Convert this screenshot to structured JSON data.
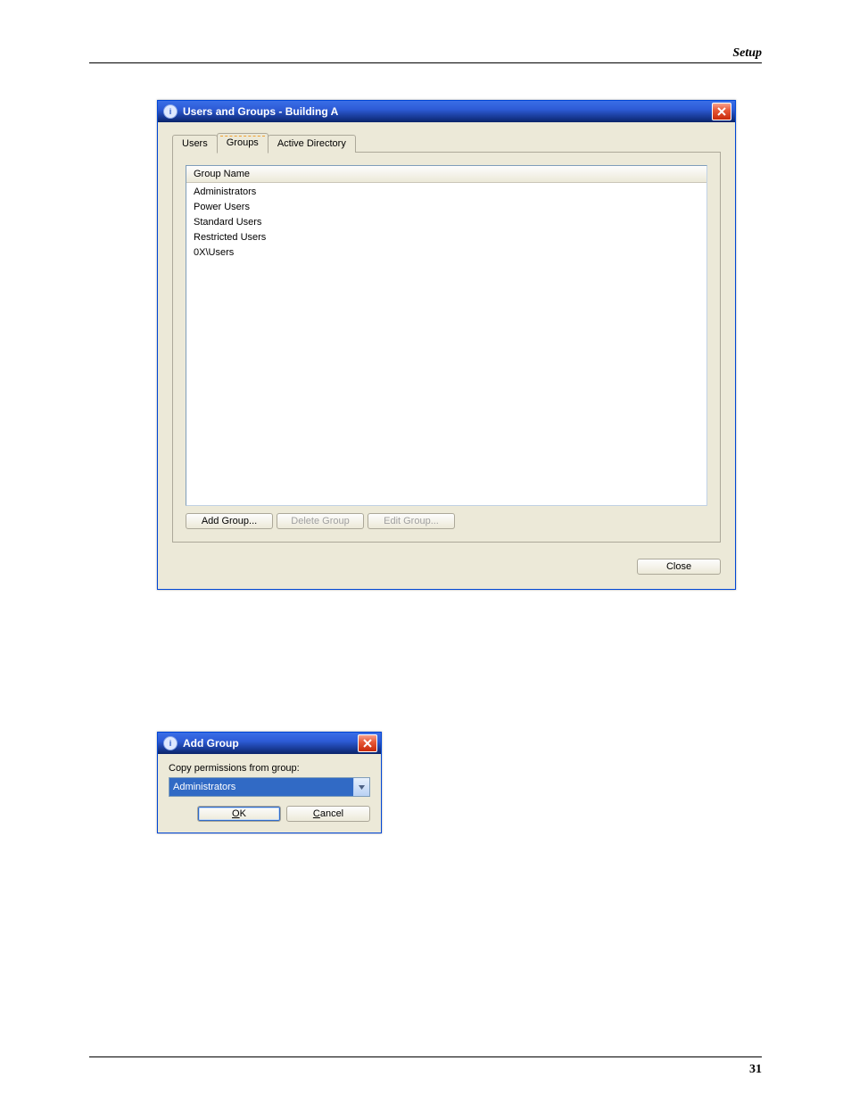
{
  "header": {
    "section": "Setup"
  },
  "footer": {
    "page_number": "31"
  },
  "dialog_main": {
    "title": "Users and Groups - Building A",
    "tabs": [
      {
        "label": "Users"
      },
      {
        "label": "Groups"
      },
      {
        "label": "Active Directory"
      }
    ],
    "active_tab_index": 1,
    "list_header": "Group Name",
    "groups": [
      "Administrators",
      "Power Users",
      "Standard Users",
      "Restricted Users",
      "0X\\Users"
    ],
    "buttons": {
      "add_group": "Add Group...",
      "delete_group": "Delete Group",
      "edit_group": "Edit Group...",
      "close": "Close"
    }
  },
  "dialog_add": {
    "title": "Add Group",
    "field_label": "Copy permissions from group:",
    "selected_group": "Administrators",
    "buttons": {
      "ok_prefix": "O",
      "ok_rest": "K",
      "cancel_prefix": "C",
      "cancel_rest": "ancel"
    }
  }
}
